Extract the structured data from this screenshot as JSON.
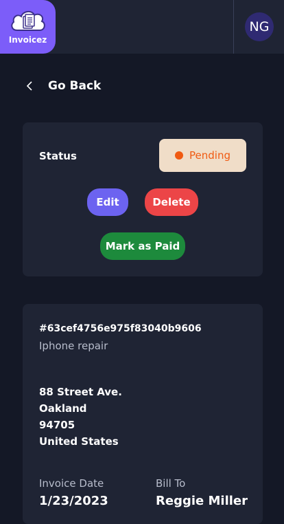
{
  "app": {
    "name": "Invoicez",
    "user_initials": "NG"
  },
  "nav": {
    "back_label": "Go Back"
  },
  "status_card": {
    "label": "Status",
    "status": "Pending",
    "status_color": "#f05a12",
    "status_bg": "#f0ddc8",
    "edit_label": "Edit",
    "delete_label": "Delete",
    "mark_paid_label": "Mark as Paid"
  },
  "invoice": {
    "id": "#63cef4756e975f83040b9606",
    "description": "Iphone repair",
    "address": [
      "88 Street Ave.",
      "Oakland",
      "94705",
      "United States"
    ],
    "invoice_date_label": "Invoice Date",
    "invoice_date": "1/23/2023",
    "bill_to_label": "Bill To",
    "bill_to": "Reggie Miller"
  },
  "colors": {
    "brand": "#7c5df9",
    "edit": "#6c63f0",
    "delete": "#ec4547",
    "paid": "#1d8a3c"
  }
}
